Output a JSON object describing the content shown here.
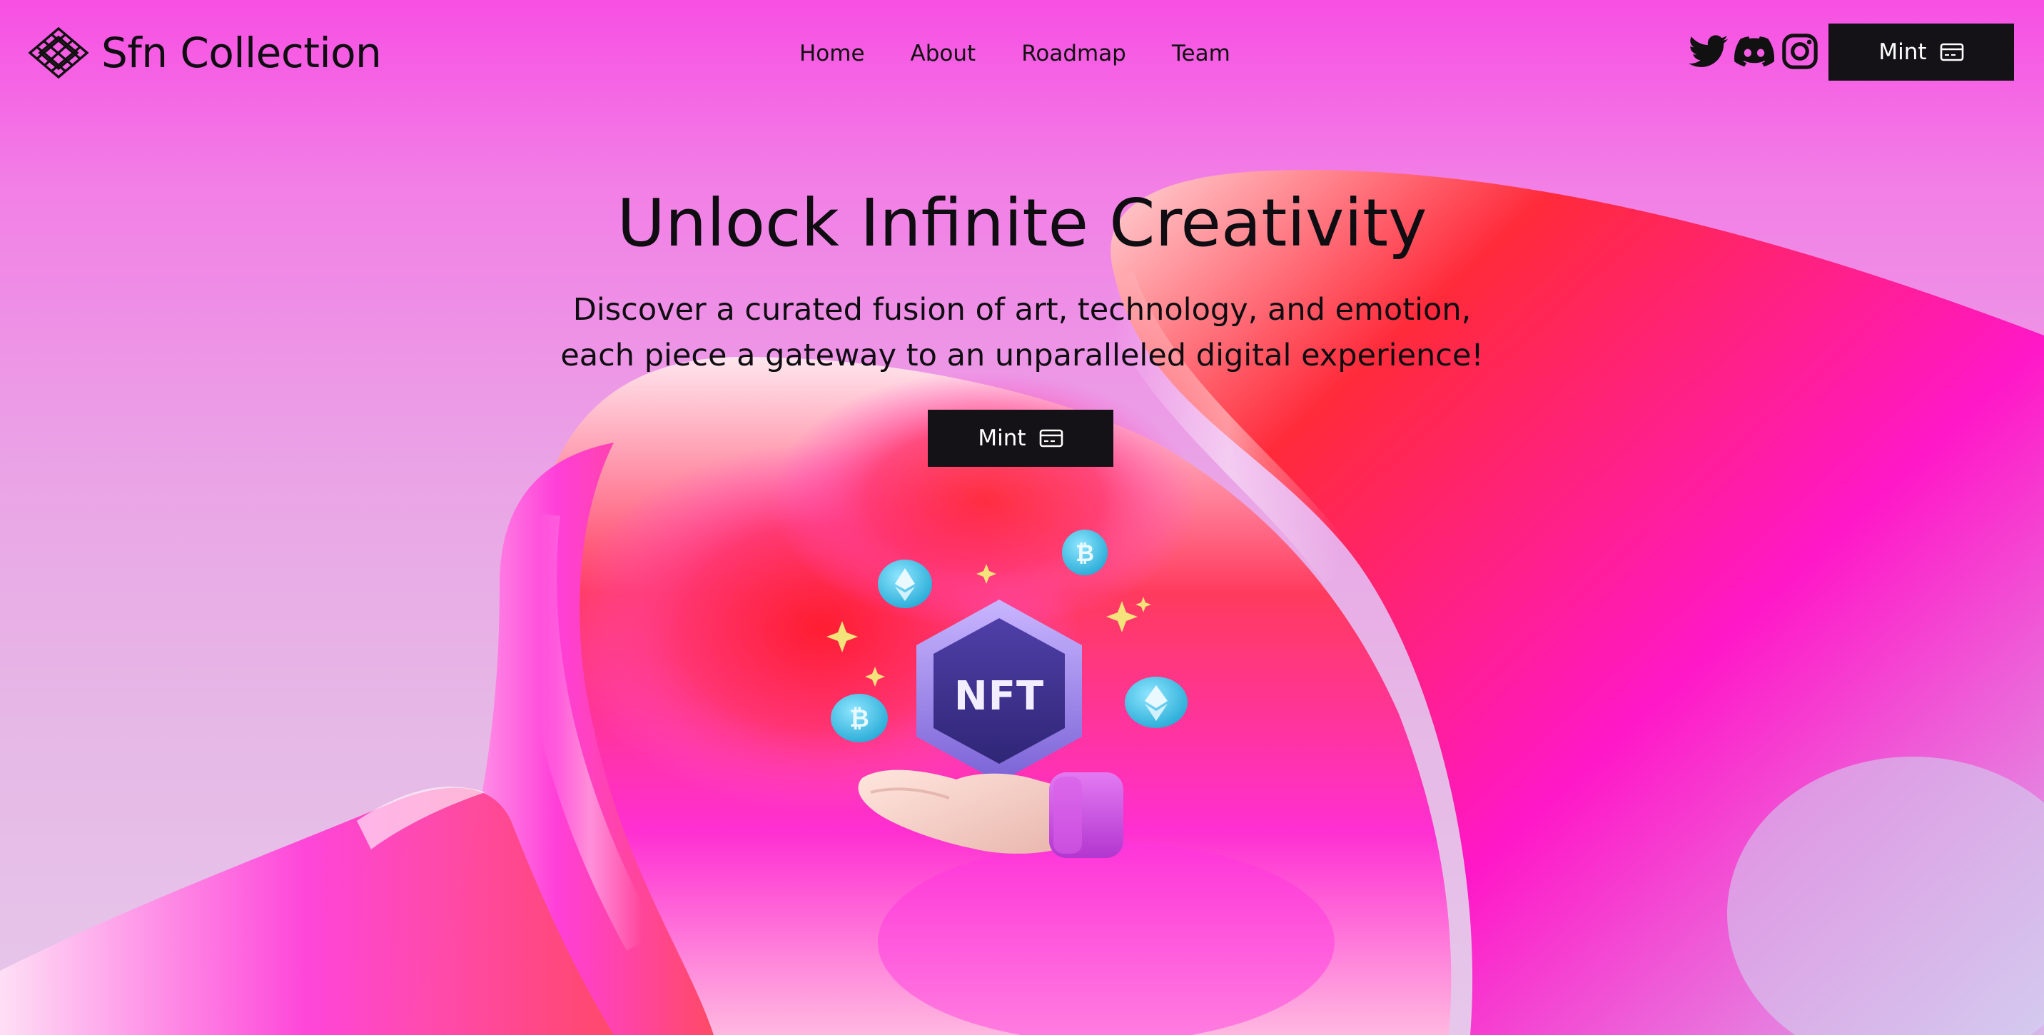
{
  "brand": {
    "name": "Sfn Collection",
    "logo_icon": "knot-logo-icon"
  },
  "nav": {
    "items": [
      {
        "label": "Home"
      },
      {
        "label": "About"
      },
      {
        "label": "Roadmap"
      },
      {
        "label": "Team"
      }
    ]
  },
  "social": {
    "icons": [
      "twitter-icon",
      "discord-icon",
      "instagram-icon"
    ]
  },
  "header_cta": {
    "label": "Mint",
    "icon": "credit-card-icon"
  },
  "hero": {
    "title": "Unlock Infinite Creativity",
    "subtitle": "Discover a curated fusion of art, technology, and emotion, each piece a gateway to an unparalleled digital experience!",
    "cta_label": "Mint",
    "cta_icon": "credit-card-icon",
    "badge_text": "NFT"
  },
  "colors": {
    "accent_dark": "#141216",
    "background_pink": "#f74fe3",
    "badge_purple": "#4a3a9e",
    "coin_cyan": "#3ec3e6",
    "sleeve_purple": "#c94be0"
  }
}
